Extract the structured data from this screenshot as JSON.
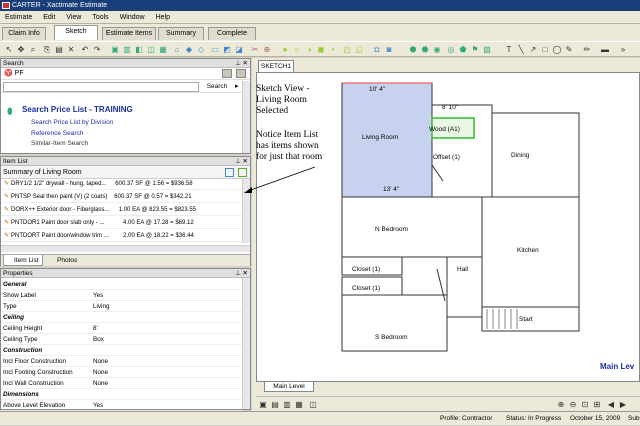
{
  "window": {
    "title": "CARTER - Xactimate Estimate"
  },
  "menu": [
    "Estimate",
    "Edit",
    "View",
    "Tools",
    "Window",
    "Help"
  ],
  "tabs": [
    "Claim Info",
    "Sketch",
    "Estimate Items",
    "Summary",
    "Complete"
  ],
  "search_panel": {
    "title": "Search",
    "field_value": "PF",
    "search_label": "Search",
    "heading": "Search Price List - TRAINING",
    "links": [
      "Search Price List by Division",
      "Reference Search",
      "Similar-Item Search"
    ]
  },
  "item_list": {
    "title": "Item List",
    "summary": "Summary of Living Room",
    "rows": [
      {
        "code": "DRY1/2",
        "desc": "1/2\" drywall - hung, taped...",
        "qty": "600.37 SF @ 1.56 = $936.58"
      },
      {
        "code": "PNTSP",
        "desc": "Seal then paint (V) (2 coats)",
        "qty": "600.37 SF @ 0.57 = $342.21"
      },
      {
        "code": "DORX++",
        "desc": "Exterior door - Fiberglass...",
        "qty": "1.00 EA @ 823.55 = $823.55"
      },
      {
        "code": "PNTDOR1",
        "desc": "Paint door slab only - ...",
        "qty": "4.00 EA @ 17.28 = $69.12"
      },
      {
        "code": "PNTDORT",
        "desc": "Paint door/window trim ...",
        "qty": "2.00 EA @ 18.22 = $36.44"
      }
    ],
    "tabs": [
      "Item List",
      "Photos"
    ]
  },
  "properties": {
    "title": "Properties",
    "rows": [
      {
        "k": "General",
        "v": "",
        "cat": true
      },
      {
        "k": "Show Label",
        "v": "Yes"
      },
      {
        "k": "Type",
        "v": "Living"
      },
      {
        "k": "Ceiling",
        "v": "",
        "cat": true
      },
      {
        "k": "Ceiling Height",
        "v": "8'"
      },
      {
        "k": "Ceiling Type",
        "v": "Box"
      },
      {
        "k": "Construction",
        "v": "",
        "cat": true
      },
      {
        "k": "Incl Floor Construction",
        "v": "None"
      },
      {
        "k": "Incl Footing Construction",
        "v": "None"
      },
      {
        "k": "Incl Wall Construction",
        "v": "None"
      },
      {
        "k": "Dimensions",
        "v": "",
        "cat": true
      },
      {
        "k": "Above Level Elevation",
        "v": "Yes"
      }
    ]
  },
  "sketch": {
    "tab": "SKETCH1",
    "level_tab": "Main Level",
    "level_label": "Main Lev",
    "rooms": [
      "Living Room",
      "Wood (A1)",
      "Offset (1)",
      "Dining",
      "N Bedroom",
      "Kitchen",
      "Closet (1)",
      "Closet (1)",
      "Hall",
      "S Bedroom",
      "Start"
    ],
    "dims": [
      "10' 4\"",
      "8' 10\"",
      "13' 4\""
    ]
  },
  "annotations": {
    "a1": [
      "Sketch View -",
      "Living Room",
      "Selected"
    ],
    "a2": [
      "Notice Item List",
      "has items shown",
      "for just that room"
    ]
  },
  "status": {
    "profile": "Profile:  Contractor",
    "status": "Status:  In Progress",
    "date": "October 15, 2009",
    "extra": "Sub"
  }
}
